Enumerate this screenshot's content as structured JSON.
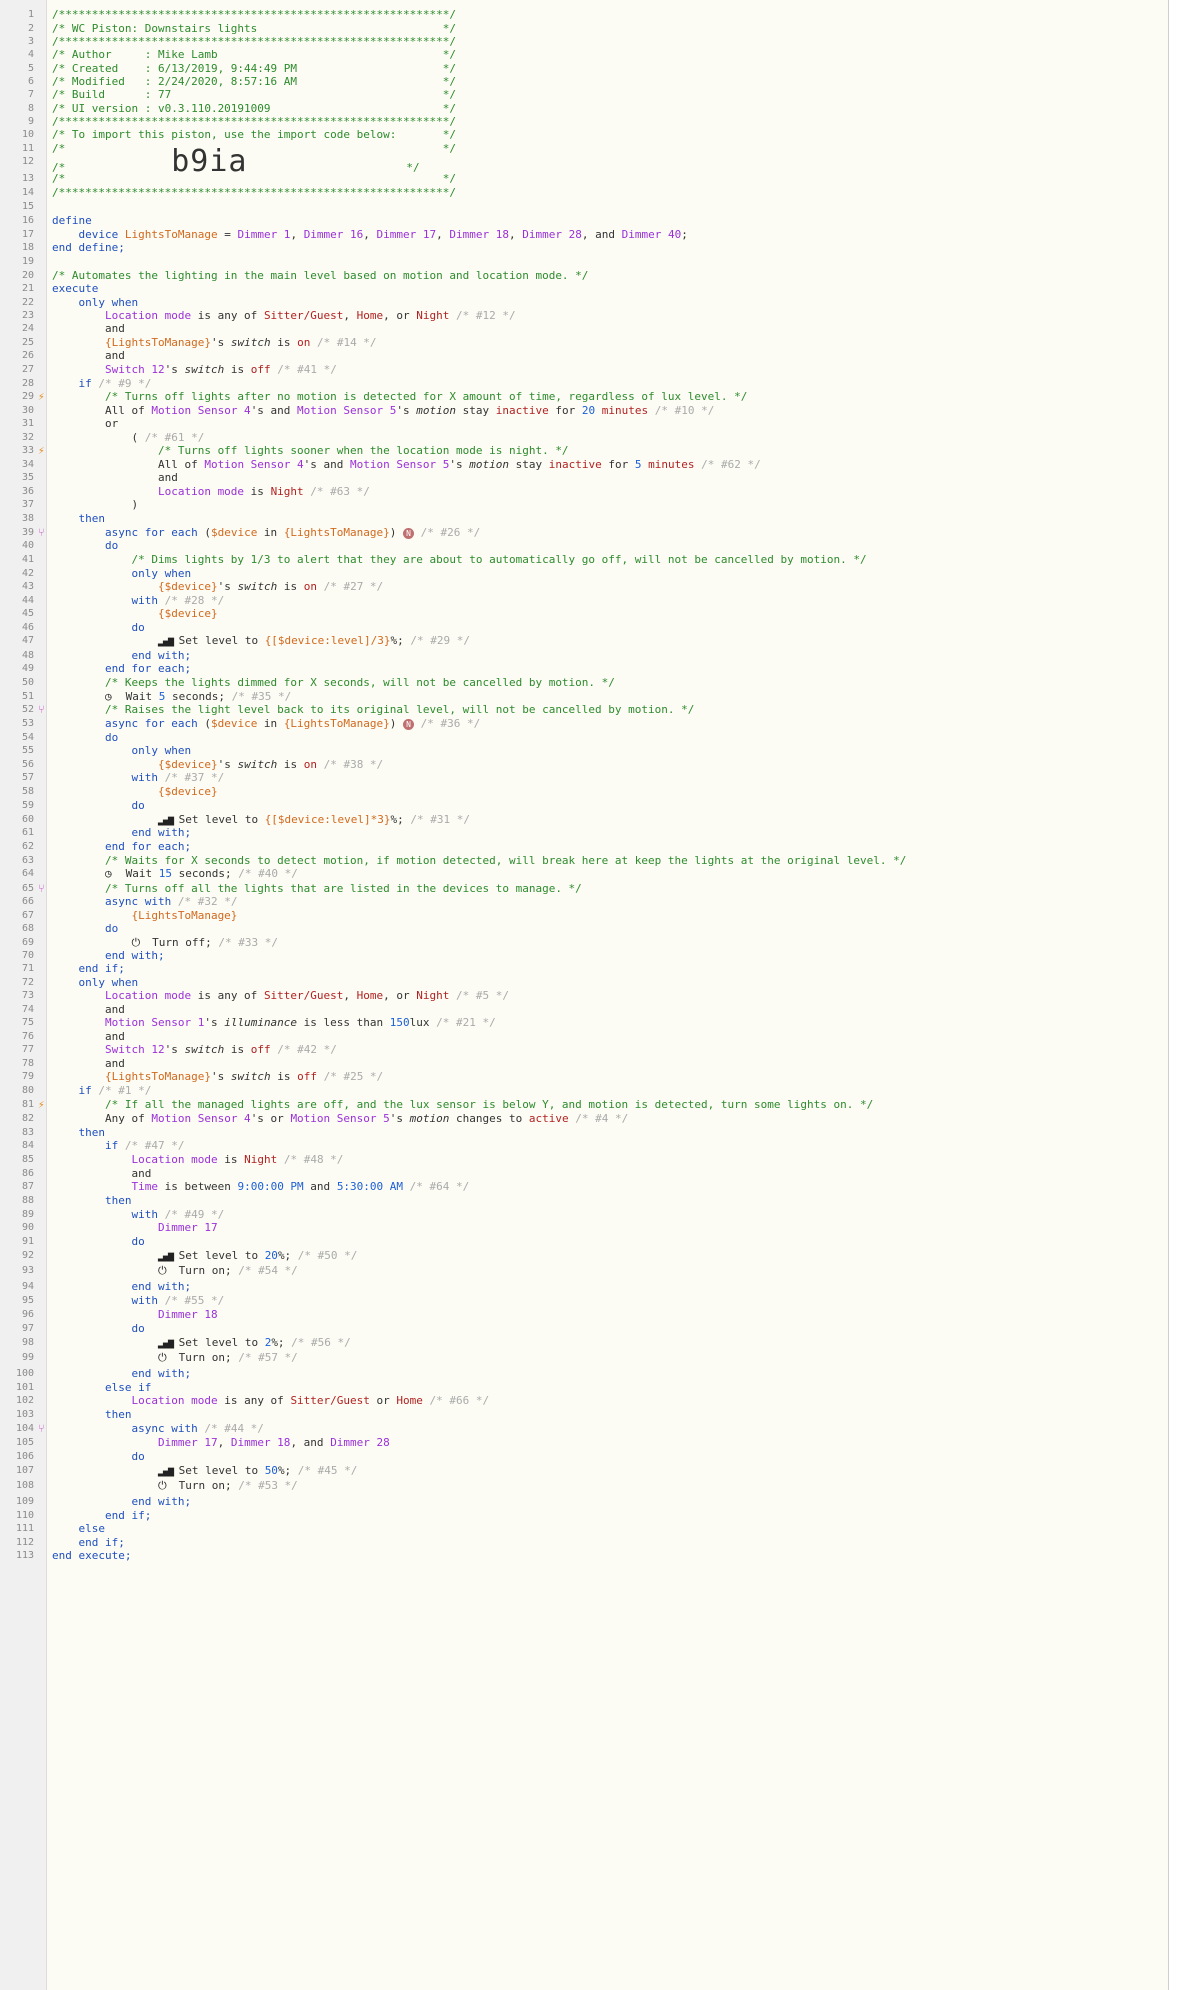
{
  "lines": [
    [
      [
        "c",
        "/***********************************************************/"
      ]
    ],
    [
      [
        "c",
        "/* WC Piston: Downstairs lights                            */"
      ]
    ],
    [
      [
        "c",
        "/***********************************************************/"
      ]
    ],
    [
      [
        "c",
        "/* Author     : Mike Lamb                                  */"
      ]
    ],
    [
      [
        "c",
        "/* Created    : 6/13/2019, 9:44:49 PM                      */"
      ]
    ],
    [
      [
        "c",
        "/* Modified   : 2/24/2020, 8:57:16 AM                      */"
      ]
    ],
    [
      [
        "c",
        "/* Build      : 77                                         */"
      ]
    ],
    [
      [
        "c",
        "/* UI version : v0.3.110.20191009                          */"
      ]
    ],
    [
      [
        "c",
        "/***********************************************************/"
      ]
    ],
    [
      [
        "c",
        "/* To import this piston, use the import code below:       */"
      ]
    ],
    [
      [
        "c",
        "/*                                                         */"
      ]
    ],
    [
      [
        "c",
        "/*                "
      ],
      [
        "big",
        "b9ia"
      ],
      [
        "c",
        "                        */"
      ]
    ],
    [
      [
        "c",
        "/*                                                         */"
      ]
    ],
    [
      [
        "c",
        "/***********************************************************/"
      ]
    ],
    [],
    [
      [
        "k",
        "define"
      ]
    ],
    [
      [
        "k",
        "    device "
      ],
      [
        "v",
        "LightsToManage"
      ],
      [
        "p",
        " = "
      ],
      [
        "d",
        "Dimmer 1"
      ],
      [
        "p",
        ", "
      ],
      [
        "d",
        "Dimmer 16"
      ],
      [
        "p",
        ", "
      ],
      [
        "d",
        "Dimmer 17"
      ],
      [
        "p",
        ", "
      ],
      [
        "d",
        "Dimmer 18"
      ],
      [
        "p",
        ", "
      ],
      [
        "d",
        "Dimmer 28"
      ],
      [
        "p",
        ", and "
      ],
      [
        "d",
        "Dimmer 40"
      ],
      [
        "p",
        ";"
      ]
    ],
    [
      [
        "k",
        "end define;"
      ]
    ],
    [],
    [
      [
        "c",
        "/* Automates the lighting in the main level based on motion and location mode. */"
      ]
    ],
    [
      [
        "k",
        "execute"
      ]
    ],
    [
      [
        "k",
        "    only when"
      ]
    ],
    [
      [
        "d",
        "        Location mode"
      ],
      [
        "p",
        " is any of "
      ],
      [
        "r",
        "Sitter/Guest"
      ],
      [
        "p",
        ", "
      ],
      [
        "r",
        "Home"
      ],
      [
        "p",
        ", or "
      ],
      [
        "r",
        "Night"
      ],
      [
        "dc",
        " /* #12 */"
      ]
    ],
    [
      [
        "p",
        "        and"
      ]
    ],
    [
      [
        "v",
        "        {LightsToManage}"
      ],
      [
        "p",
        "'s "
      ],
      [
        "i",
        "switch"
      ],
      [
        "p",
        " is "
      ],
      [
        "r",
        "on"
      ],
      [
        "dc",
        " /* #14 */"
      ]
    ],
    [
      [
        "p",
        "        and"
      ]
    ],
    [
      [
        "d",
        "        Switch 12"
      ],
      [
        "p",
        "'s "
      ],
      [
        "i",
        "switch"
      ],
      [
        "p",
        " is "
      ],
      [
        "r",
        "off"
      ],
      [
        "dc",
        " /* #41 */"
      ]
    ],
    [
      [
        "k",
        "    if"
      ],
      [
        "dc",
        " /* #9 */"
      ]
    ],
    [
      [
        "c",
        "        /* Turns off lights after no motion is detected for X amount of time, regardless of lux level. */"
      ]
    ],
    [
      [
        "p",
        "        All of "
      ],
      [
        "d",
        "Motion Sensor 4"
      ],
      [
        "p",
        "'s and "
      ],
      [
        "d",
        "Motion Sensor 5"
      ],
      [
        "p",
        "'s "
      ],
      [
        "i",
        "motion"
      ],
      [
        "p",
        " stay "
      ],
      [
        "r",
        "inactive"
      ],
      [
        "p",
        " for "
      ],
      [
        "n",
        "20"
      ],
      [
        "r",
        " minutes"
      ],
      [
        "dc",
        " /* #10 */"
      ]
    ],
    [
      [
        "p",
        "        or"
      ]
    ],
    [
      [
        "p",
        "            ( "
      ],
      [
        "dc",
        "/* #61 */"
      ]
    ],
    [
      [
        "c",
        "                /* Turns off lights sooner when the location mode is night. */"
      ]
    ],
    [
      [
        "p",
        "                All of "
      ],
      [
        "d",
        "Motion Sensor 4"
      ],
      [
        "p",
        "'s and "
      ],
      [
        "d",
        "Motion Sensor 5"
      ],
      [
        "p",
        "'s "
      ],
      [
        "i",
        "motion"
      ],
      [
        "p",
        " stay "
      ],
      [
        "r",
        "inactive"
      ],
      [
        "p",
        " for "
      ],
      [
        "n",
        "5"
      ],
      [
        "r",
        " minutes"
      ],
      [
        "dc",
        " /* #62 */"
      ]
    ],
    [
      [
        "p",
        "                and"
      ]
    ],
    [
      [
        "d",
        "                Location mode"
      ],
      [
        "p",
        " is "
      ],
      [
        "r",
        "Night"
      ],
      [
        "dc",
        " /* #63 */"
      ]
    ],
    [
      [
        "p",
        "            )"
      ]
    ],
    [
      [
        "k",
        "    then"
      ]
    ],
    [
      [
        "k",
        "        async for each"
      ],
      [
        "p",
        " ("
      ],
      [
        "v",
        "$device"
      ],
      [
        "p",
        " in "
      ],
      [
        "v",
        "{LightsToManage}"
      ],
      [
        "p",
        ") "
      ],
      [
        "badge",
        "N"
      ],
      [
        "dc",
        " /* #26 */"
      ]
    ],
    [
      [
        "k",
        "        do"
      ]
    ],
    [
      [
        "c",
        "            /* Dims lights by 1/3 to alert that they are about to automatically go off, will not be cancelled by motion. */"
      ]
    ],
    [
      [
        "k",
        "            only when"
      ]
    ],
    [
      [
        "v",
        "                {$device}"
      ],
      [
        "p",
        "'s "
      ],
      [
        "i",
        "switch"
      ],
      [
        "p",
        " is "
      ],
      [
        "r",
        "on"
      ],
      [
        "dc",
        " /* #27 */"
      ]
    ],
    [
      [
        "k",
        "            with"
      ],
      [
        "dc",
        " /* #28 */"
      ]
    ],
    [
      [
        "v",
        "                {$device}"
      ]
    ],
    [
      [
        "k",
        "            do"
      ]
    ],
    [
      [
        "ico",
        "                ▐▐▌"
      ],
      [
        "s",
        " Set level to "
      ],
      [
        "v",
        "{[$device:level]/3}"
      ],
      [
        "p",
        "%;"
      ],
      [
        "dc",
        " /* #29 */"
      ]
    ],
    [
      [
        "k",
        "            end with;"
      ]
    ],
    [
      [
        "k",
        "        end for each;"
      ]
    ],
    [
      [
        "c",
        "        /* Keeps the lights dimmed for X seconds, will not be cancelled by motion. */"
      ]
    ],
    [
      [
        "ico",
        "        ◷"
      ],
      [
        "s",
        " Wait "
      ],
      [
        "n",
        "5"
      ],
      [
        "s",
        " seconds;"
      ],
      [
        "dc",
        " /* #35 */"
      ]
    ],
    [
      [
        "c",
        "        /* Raises the light level back to its original level, will not be cancelled by motion. */"
      ]
    ],
    [
      [
        "k",
        "        async for each"
      ],
      [
        "p",
        " ("
      ],
      [
        "v",
        "$device"
      ],
      [
        "p",
        " in "
      ],
      [
        "v",
        "{LightsToManage}"
      ],
      [
        "p",
        ") "
      ],
      [
        "badge",
        "N"
      ],
      [
        "dc",
        " /* #36 */"
      ]
    ],
    [
      [
        "k",
        "        do"
      ]
    ],
    [
      [
        "k",
        "            only when"
      ]
    ],
    [
      [
        "v",
        "                {$device}"
      ],
      [
        "p",
        "'s "
      ],
      [
        "i",
        "switch"
      ],
      [
        "p",
        " is "
      ],
      [
        "r",
        "on"
      ],
      [
        "dc",
        " /* #38 */"
      ]
    ],
    [
      [
        "k",
        "            with"
      ],
      [
        "dc",
        " /* #37 */"
      ]
    ],
    [
      [
        "v",
        "                {$device}"
      ]
    ],
    [
      [
        "k",
        "            do"
      ]
    ],
    [
      [
        "ico",
        "                ▐▐▌"
      ],
      [
        "s",
        " Set level to "
      ],
      [
        "v",
        "{[$device:level]*3}"
      ],
      [
        "p",
        "%;"
      ],
      [
        "dc",
        " /* #31 */"
      ]
    ],
    [
      [
        "k",
        "            end with;"
      ]
    ],
    [
      [
        "k",
        "        end for each;"
      ]
    ],
    [
      [
        "c",
        "        /* Waits for X seconds to detect motion, if motion detected, will break here at keep the lights at the original level. */"
      ]
    ],
    [
      [
        "ico",
        "        ◷"
      ],
      [
        "s",
        " Wait "
      ],
      [
        "n",
        "15"
      ],
      [
        "s",
        " seconds;"
      ],
      [
        "dc",
        " /* #40 */"
      ]
    ],
    [
      [
        "c",
        "        /* Turns off all the lights that are listed in the devices to manage. */"
      ]
    ],
    [
      [
        "k",
        "        async with"
      ],
      [
        "dc",
        " /* #32 */"
      ]
    ],
    [
      [
        "v",
        "            {LightsToManage}"
      ]
    ],
    [
      [
        "k",
        "        do"
      ]
    ],
    [
      [
        "ico",
        "            ⏻"
      ],
      [
        "s",
        " Turn off;"
      ],
      [
        "dc",
        " /* #33 */"
      ]
    ],
    [
      [
        "k",
        "        end with;"
      ]
    ],
    [
      [
        "k",
        "    end if;"
      ]
    ],
    [
      [
        "k",
        "    only when"
      ]
    ],
    [
      [
        "d",
        "        Location mode"
      ],
      [
        "p",
        " is any of "
      ],
      [
        "r",
        "Sitter/Guest"
      ],
      [
        "p",
        ", "
      ],
      [
        "r",
        "Home"
      ],
      [
        "p",
        ", or "
      ],
      [
        "r",
        "Night"
      ],
      [
        "dc",
        " /* #5 */"
      ]
    ],
    [
      [
        "p",
        "        and"
      ]
    ],
    [
      [
        "d",
        "        Motion Sensor 1"
      ],
      [
        "p",
        "'s "
      ],
      [
        "i",
        "illuminance"
      ],
      [
        "p",
        " is less than "
      ],
      [
        "n",
        "150"
      ],
      [
        "p",
        "lux"
      ],
      [
        "dc",
        " /* #21 */"
      ]
    ],
    [
      [
        "p",
        "        and"
      ]
    ],
    [
      [
        "d",
        "        Switch 12"
      ],
      [
        "p",
        "'s "
      ],
      [
        "i",
        "switch"
      ],
      [
        "p",
        " is "
      ],
      [
        "r",
        "off"
      ],
      [
        "dc",
        " /* #42 */"
      ]
    ],
    [
      [
        "p",
        "        and"
      ]
    ],
    [
      [
        "v",
        "        {LightsToManage}"
      ],
      [
        "p",
        "'s "
      ],
      [
        "i",
        "switch"
      ],
      [
        "p",
        " is "
      ],
      [
        "r",
        "off"
      ],
      [
        "dc",
        " /* #25 */"
      ]
    ],
    [
      [
        "k",
        "    if"
      ],
      [
        "dc",
        " /* #1 */"
      ]
    ],
    [
      [
        "c",
        "        /* If all the managed lights are off, and the lux sensor is below Y, and motion is detected, turn some lights on. */"
      ]
    ],
    [
      [
        "p",
        "        Any of "
      ],
      [
        "d",
        "Motion Sensor 4"
      ],
      [
        "p",
        "'s or "
      ],
      [
        "d",
        "Motion Sensor 5"
      ],
      [
        "p",
        "'s "
      ],
      [
        "i",
        "motion"
      ],
      [
        "p",
        " changes to "
      ],
      [
        "r",
        "active"
      ],
      [
        "dc",
        " /* #4 */"
      ]
    ],
    [
      [
        "k",
        "    then"
      ]
    ],
    [
      [
        "k",
        "        if"
      ],
      [
        "dc",
        " /* #47 */"
      ]
    ],
    [
      [
        "d",
        "            Location mode"
      ],
      [
        "p",
        " is "
      ],
      [
        "r",
        "Night"
      ],
      [
        "dc",
        " /* #48 */"
      ]
    ],
    [
      [
        "p",
        "            and"
      ]
    ],
    [
      [
        "d",
        "            Time"
      ],
      [
        "p",
        " is between "
      ],
      [
        "n",
        "9:00:00 PM"
      ],
      [
        "p",
        " and "
      ],
      [
        "n",
        "5:30:00 AM"
      ],
      [
        "dc",
        " /* #64 */"
      ]
    ],
    [
      [
        "k",
        "        then"
      ]
    ],
    [
      [
        "k",
        "            with"
      ],
      [
        "dc",
        " /* #49 */"
      ]
    ],
    [
      [
        "d",
        "                Dimmer 17"
      ]
    ],
    [
      [
        "k",
        "            do"
      ]
    ],
    [
      [
        "ico",
        "                ▐▐▌"
      ],
      [
        "s",
        " Set level to "
      ],
      [
        "n",
        "20"
      ],
      [
        "p",
        "%;"
      ],
      [
        "dc",
        " /* #50 */"
      ]
    ],
    [
      [
        "ico",
        "                ⏻"
      ],
      [
        "s",
        " Turn on;"
      ],
      [
        "dc",
        " /* #54 */"
      ]
    ],
    [
      [
        "k",
        "            end with;"
      ]
    ],
    [
      [
        "k",
        "            with"
      ],
      [
        "dc",
        " /* #55 */"
      ]
    ],
    [
      [
        "d",
        "                Dimmer 18"
      ]
    ],
    [
      [
        "k",
        "            do"
      ]
    ],
    [
      [
        "ico",
        "                ▐▐▌"
      ],
      [
        "s",
        " Set level to "
      ],
      [
        "n",
        "2"
      ],
      [
        "p",
        "%;"
      ],
      [
        "dc",
        " /* #56 */"
      ]
    ],
    [
      [
        "ico",
        "                ⏻"
      ],
      [
        "s",
        " Turn on;"
      ],
      [
        "dc",
        " /* #57 */"
      ]
    ],
    [
      [
        "k",
        "            end with;"
      ]
    ],
    [
      [
        "k",
        "        else if"
      ]
    ],
    [
      [
        "d",
        "            Location mode"
      ],
      [
        "p",
        " is any of "
      ],
      [
        "r",
        "Sitter/Guest"
      ],
      [
        "p",
        " or "
      ],
      [
        "r",
        "Home"
      ],
      [
        "dc",
        " /* #66 */"
      ]
    ],
    [
      [
        "k",
        "        then"
      ]
    ],
    [
      [
        "k",
        "            async with"
      ],
      [
        "dc",
        " /* #44 */"
      ]
    ],
    [
      [
        "d",
        "                Dimmer 17"
      ],
      [
        "p",
        ", "
      ],
      [
        "d",
        "Dimmer 18"
      ],
      [
        "p",
        ", and "
      ],
      [
        "d",
        "Dimmer 28"
      ]
    ],
    [
      [
        "k",
        "            do"
      ]
    ],
    [
      [
        "ico",
        "                ▐▐▌"
      ],
      [
        "s",
        " Set level to "
      ],
      [
        "n",
        "50"
      ],
      [
        "p",
        "%;"
      ],
      [
        "dc",
        " /* #45 */"
      ]
    ],
    [
      [
        "ico",
        "                ⏻"
      ],
      [
        "s",
        " Turn on;"
      ],
      [
        "dc",
        " /* #53 */"
      ]
    ],
    [
      [
        "k",
        "            end with;"
      ]
    ],
    [
      [
        "k",
        "        end if;"
      ]
    ],
    [
      [
        "k",
        "    else"
      ]
    ],
    [
      [
        "k",
        "    end if;"
      ]
    ],
    [
      [
        "k",
        "end execute;"
      ]
    ]
  ],
  "gutter_markers": {
    "29": "bolt",
    "33": "bolt",
    "81": "bolt",
    "39": "fork",
    "52": "fork",
    "65": "fork",
    "104": "fork"
  },
  "icons": {
    "level": "signal-bars-icon",
    "wait": "clock-icon",
    "power": "power-icon",
    "bolt": "lightning-bolt-icon",
    "fork": "async-fork-icon",
    "badge": "n-badge-icon"
  }
}
